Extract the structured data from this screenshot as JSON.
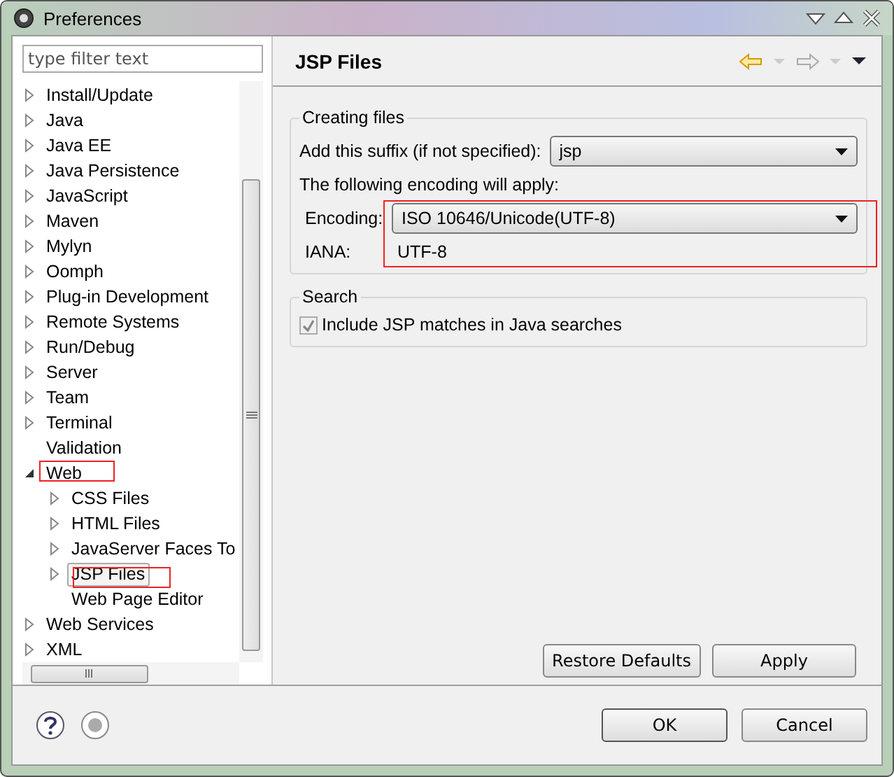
{
  "window": {
    "title": "Preferences"
  },
  "filter": {
    "placeholder": "type filter text"
  },
  "tree": [
    {
      "label": "Install/Update",
      "expandable": true,
      "expanded": false,
      "selected": false,
      "highlighted": false
    },
    {
      "label": "Java",
      "expandable": true,
      "expanded": false,
      "selected": false,
      "highlighted": false
    },
    {
      "label": "Java EE",
      "expandable": true,
      "expanded": false,
      "selected": false,
      "highlighted": false
    },
    {
      "label": "Java Persistence",
      "expandable": true,
      "expanded": false,
      "selected": false,
      "highlighted": false
    },
    {
      "label": "JavaScript",
      "expandable": true,
      "expanded": false,
      "selected": false,
      "highlighted": false
    },
    {
      "label": "Maven",
      "expandable": true,
      "expanded": false,
      "selected": false,
      "highlighted": false
    },
    {
      "label": "Mylyn",
      "expandable": true,
      "expanded": false,
      "selected": false,
      "highlighted": false
    },
    {
      "label": "Oomph",
      "expandable": true,
      "expanded": false,
      "selected": false,
      "highlighted": false
    },
    {
      "label": "Plug-in Development",
      "expandable": true,
      "expanded": false,
      "selected": false,
      "highlighted": false
    },
    {
      "label": "Remote Systems",
      "expandable": true,
      "expanded": false,
      "selected": false,
      "highlighted": false
    },
    {
      "label": "Run/Debug",
      "expandable": true,
      "expanded": false,
      "selected": false,
      "highlighted": false
    },
    {
      "label": "Server",
      "expandable": true,
      "expanded": false,
      "selected": false,
      "highlighted": false
    },
    {
      "label": "Team",
      "expandable": true,
      "expanded": false,
      "selected": false,
      "highlighted": false
    },
    {
      "label": "Terminal",
      "expandable": true,
      "expanded": false,
      "selected": false,
      "highlighted": false
    },
    {
      "label": "Validation",
      "expandable": false,
      "selected": false,
      "highlighted": false
    },
    {
      "label": "Web",
      "expandable": true,
      "expanded": true,
      "selected": false,
      "highlighted": true,
      "children": [
        {
          "label": "CSS Files",
          "expandable": true,
          "expanded": false,
          "selected": false,
          "highlighted": false
        },
        {
          "label": "HTML Files",
          "expandable": true,
          "expanded": false,
          "selected": false,
          "highlighted": false
        },
        {
          "label": "JavaServer Faces To",
          "expandable": true,
          "expanded": false,
          "selected": false,
          "highlighted": false
        },
        {
          "label": "JSP Files",
          "expandable": true,
          "expanded": false,
          "selected": true,
          "highlighted": true
        },
        {
          "label": "Web Page Editor",
          "expandable": false,
          "selected": false,
          "highlighted": false
        }
      ]
    },
    {
      "label": "Web Services",
      "expandable": true,
      "expanded": false,
      "selected": false,
      "highlighted": false
    },
    {
      "label": "XML",
      "expandable": true,
      "expanded": false,
      "selected": false,
      "highlighted": false
    }
  ],
  "page": {
    "title": "JSP Files",
    "creating": {
      "title": "Creating files",
      "suffix_label": "Add this suffix (if not specified):",
      "suffix_value": "jsp",
      "encoding_note": "The following encoding will apply:",
      "encoding_label": "Encoding:",
      "encoding_value": "ISO 10646/Unicode(UTF-8)",
      "iana_label": "IANA:",
      "iana_value": "UTF-8",
      "highlighted": true
    },
    "search": {
      "title": "Search",
      "option": {
        "label": "Include JSP matches in Java searches",
        "checked": true,
        "disabled": true
      }
    },
    "buttons": [
      "Restore Defaults",
      "Apply"
    ]
  },
  "dialog_buttons": [
    "OK",
    "Cancel"
  ]
}
